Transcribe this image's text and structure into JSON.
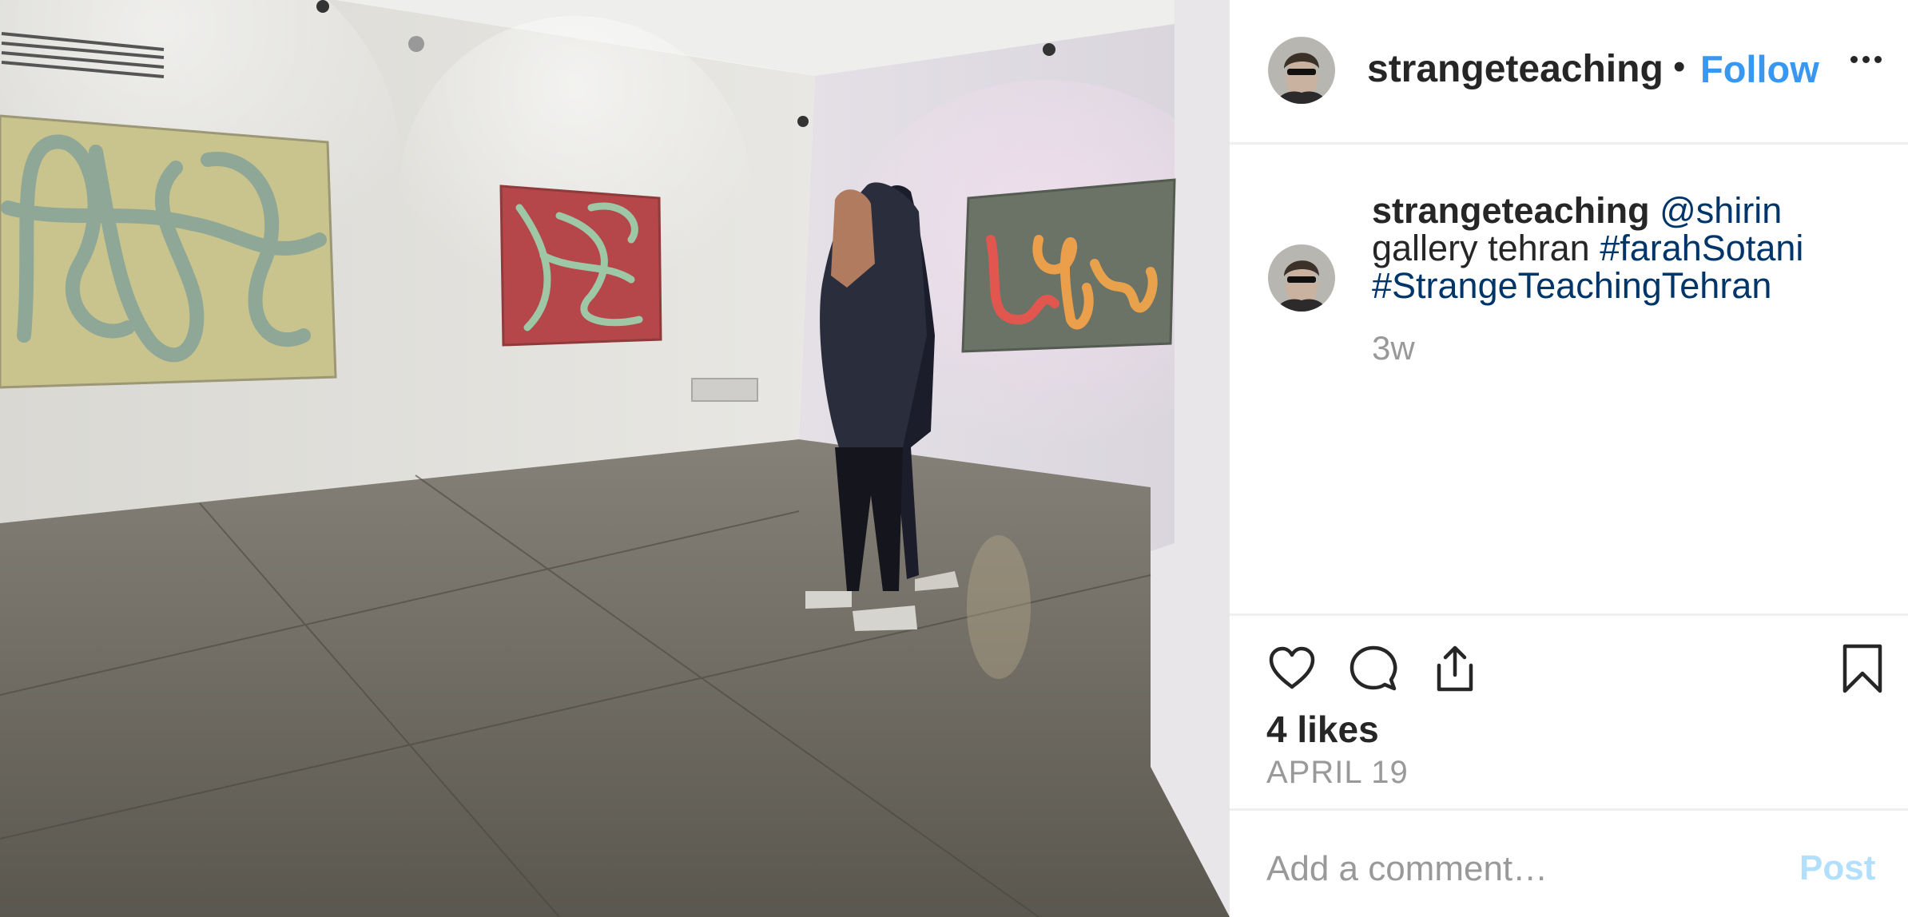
{
  "post": {
    "username": "strangeteaching",
    "separator": "•",
    "follow_label": "Follow",
    "more_icon": "more-horizontal-icon",
    "caption": {
      "username": "strangeteaching",
      "mention": "@shirin",
      "text": "gallery tehran",
      "hashtag_1": "#farahSotani",
      "hashtag_2": "#StrangeTeachingTehran"
    },
    "time_ago": "3w",
    "likes": "4 likes",
    "date": "APRIL 19"
  },
  "actions": {
    "like_icon": "heart-icon",
    "comment_icon": "comment-bubble-icon",
    "share_icon": "share-upload-icon",
    "save_icon": "bookmark-icon"
  },
  "comment": {
    "placeholder": "Add a comment…",
    "post_label": "Post"
  },
  "colors": {
    "follow": "#3897f0",
    "hashtag": "#003569",
    "muted": "#999999",
    "post_disabled": "#b2dffc"
  }
}
